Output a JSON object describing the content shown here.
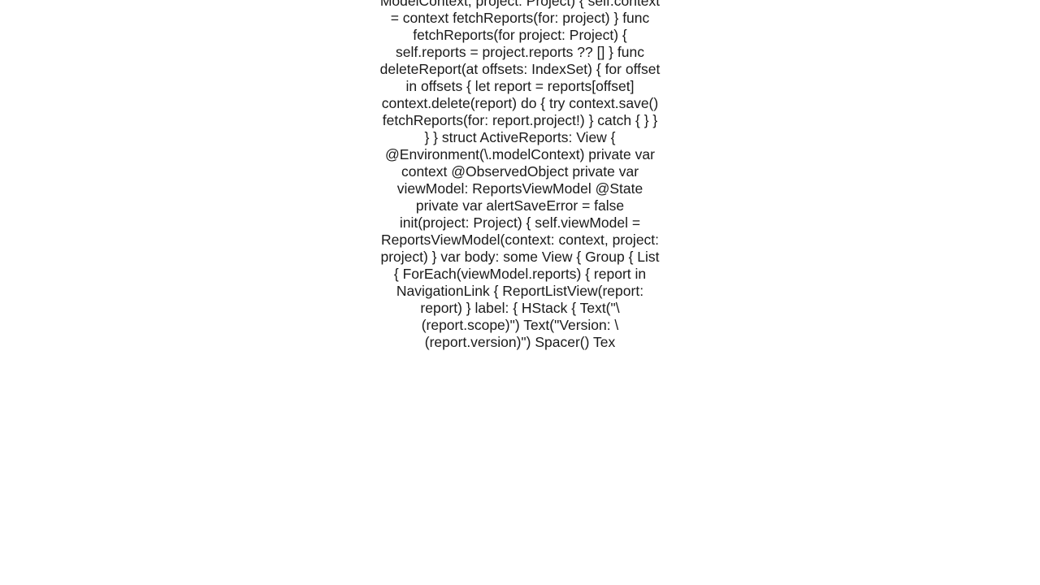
{
  "code_text": "context: ModelContext      init(context: ModelContext, project: Project) {         self.context = context         fetchReports(for: project)     }          func fetchReports(for project: Project) {         self.reports = project.reports ?? []     }          func deleteReport(at offsets: IndexSet) {         for offset in offsets {             let report = reports[offset]             context.delete(report)             do {                 try context.save()                 fetchReports(for: report.project!)             } catch {             }         }     }     }  struct ActiveReports: View {     @Environment(\\.modelContext) private var context     @ObservedObject private var viewModel: ReportsViewModel     @State private var alertSaveError = false          init(project: Project) {         self.viewModel = ReportsViewModel(context: context, project: project)     }          var body: some View {         Group {             List {                 ForEach(viewModel.reports) { report in                     NavigationLink {                         ReportListView(report: report)                     } label: {                         HStack {                             Text(\"\\(report.scope)\")                             Text(\"Version: \\(report.version)\")                             Spacer()                             Tex"
}
